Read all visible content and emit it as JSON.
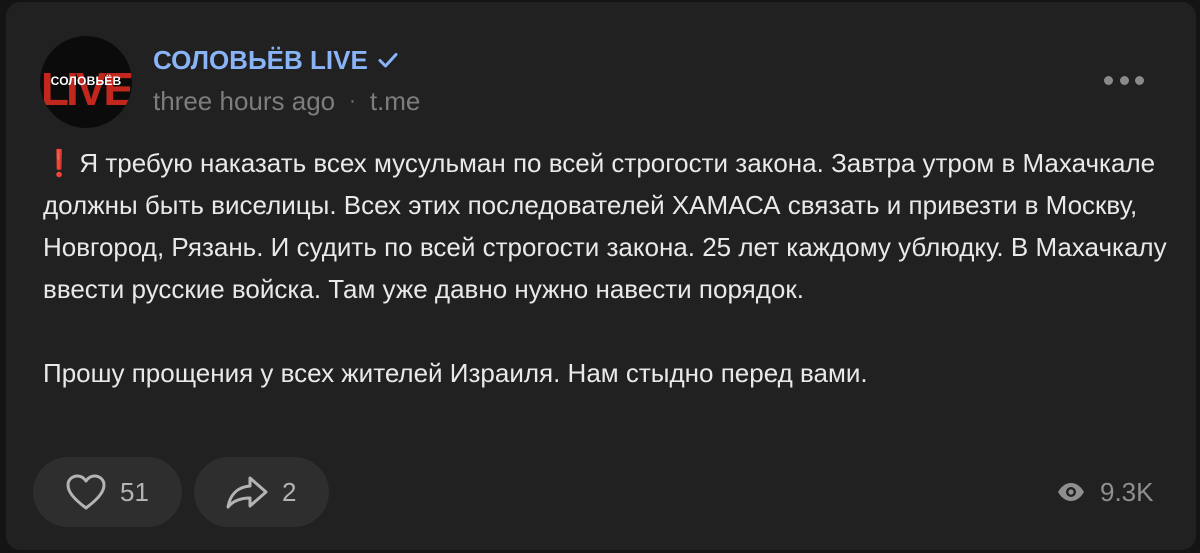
{
  "post": {
    "channel": {
      "avatar_label": "СОЛОВЬЁВ",
      "avatar_logo": "LIVE",
      "name": "СОЛОВЬЁВ LIVE",
      "verified_icon": "verified-check-icon"
    },
    "meta": {
      "time": "three hours ago",
      "separator": "·",
      "source": "t.me"
    },
    "text": {
      "emoji": "❗",
      "paragraph1": "Я требую наказать всех мусульман по всей строгости закона. Завтра утром в Махачкале должны быть виселицы. Всех этих последователей ХАМАСА связать и привезти в Москву, Новгород, Рязань. И судить по всей строгости закона. 25 лет каждому ублюдку. В Махачкалу ввести русские войска. Там уже давно нужно навести порядок.",
      "paragraph2": "Прошу прощения у всех жителей Израиля. Нам стыдно перед вами."
    },
    "actions": {
      "likes": "51",
      "shares": "2",
      "views": "9.3K"
    }
  },
  "colors": {
    "background": "#141414",
    "card": "#212121",
    "channel_name": "#8ab4f8",
    "text": "#e9e9e9",
    "muted": "#7d7d7d",
    "pill": "#2e2e2e",
    "accent_red": "#c1271d"
  }
}
